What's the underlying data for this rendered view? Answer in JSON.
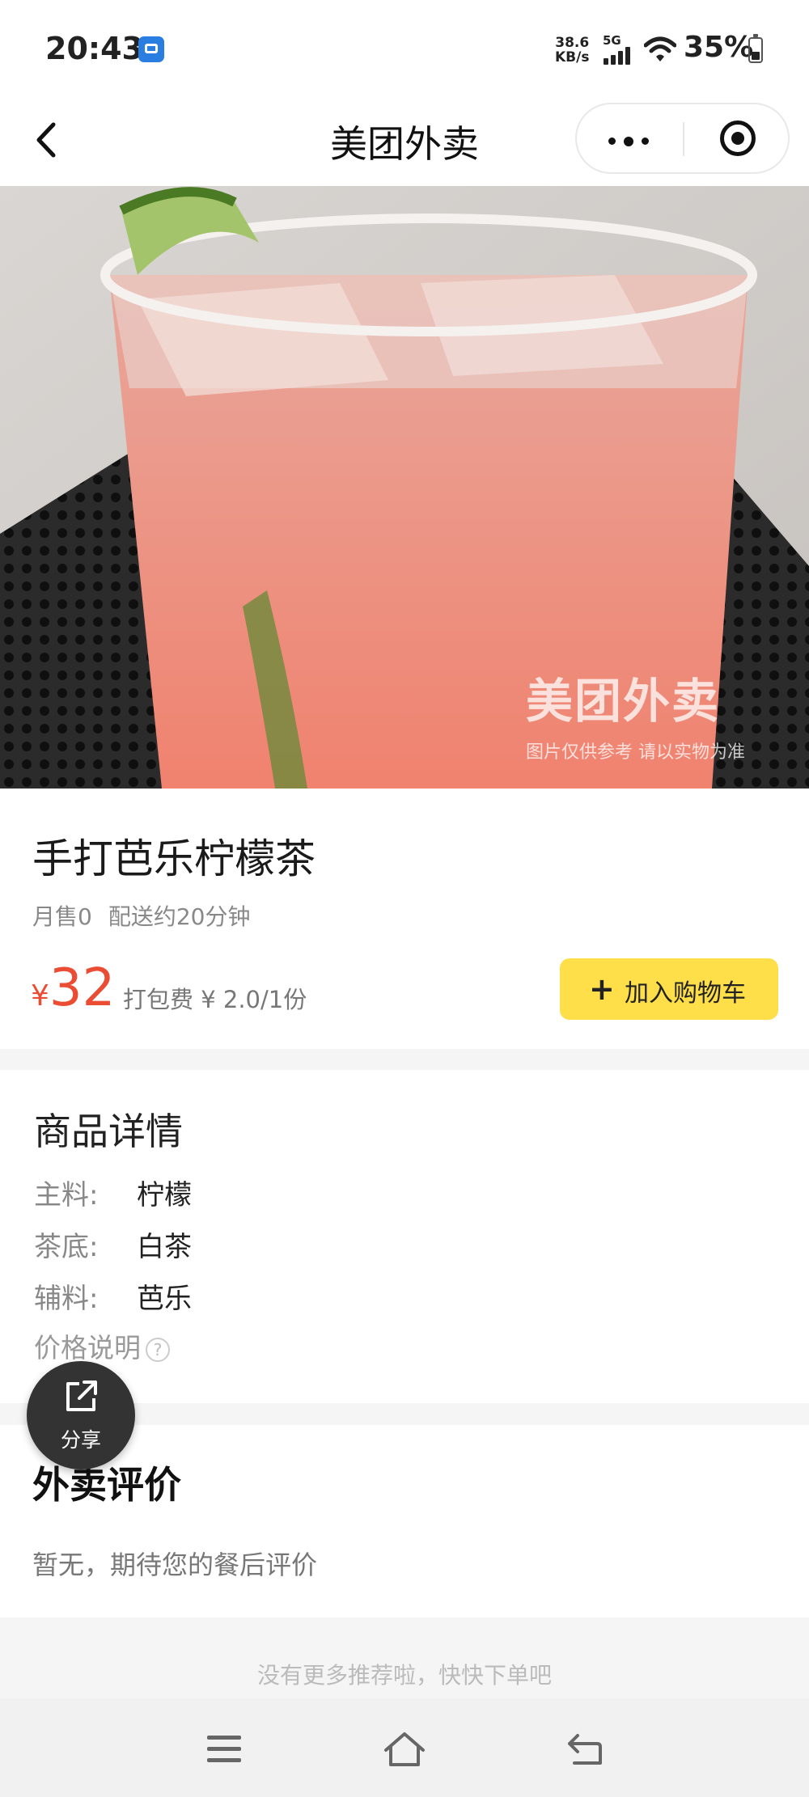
{
  "status_bar": {
    "time": "20:43",
    "net_speed_value": "38.6",
    "net_speed_unit": "KB/s",
    "network": "5G",
    "battery": "35%"
  },
  "nav": {
    "title": "美团外卖"
  },
  "image": {
    "watermark_brand": "美团外卖",
    "watermark_note": "图片仅供参考 请以实物为准"
  },
  "product": {
    "name": "手打芭乐柠檬茶",
    "monthly_sales": "月售0",
    "delivery": "配送约20分钟",
    "currency": "¥",
    "price": "32",
    "packing_fee": "打包费 ¥ 2.0/1份",
    "add_to_cart": "加入购物车"
  },
  "details": {
    "title": "商品详情",
    "rows": [
      {
        "key": "主料:",
        "value": "柠檬"
      },
      {
        "key": "茶底:",
        "value": "白茶"
      },
      {
        "key": "辅料:",
        "value": "芭乐"
      }
    ],
    "price_note": "价格说明"
  },
  "share": {
    "label": "分享"
  },
  "reviews": {
    "title": "外卖评价",
    "empty": "暂无，期待您的餐后评价"
  },
  "footer": {
    "no_more": "没有更多推荐啦，快快下单吧"
  },
  "colors": {
    "price": "#ea4d33",
    "cart_button": "#ffdf49",
    "drink": "#f09a8c"
  }
}
